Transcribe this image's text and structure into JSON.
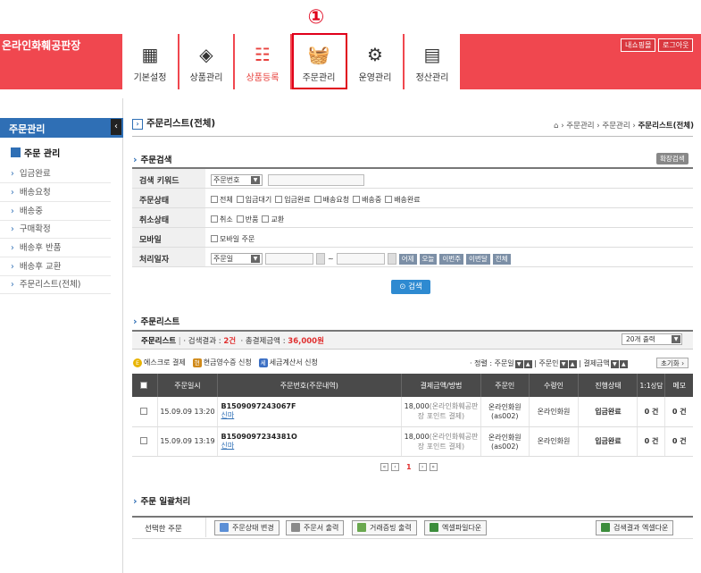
{
  "callout": "①",
  "header": {
    "logo": "온라인화훼공판장",
    "nav": [
      {
        "label": "기본설정",
        "icon": "grid-icon"
      },
      {
        "label": "상품관리",
        "icon": "tag-icon"
      },
      {
        "label": "상품등록",
        "icon": "register-icon"
      },
      {
        "label": "주문관리",
        "icon": "basket-icon"
      },
      {
        "label": "운영관리",
        "icon": "gears-icon"
      },
      {
        "label": "정산관리",
        "icon": "calculator-icon"
      }
    ],
    "my_mall": "내쇼핑몰",
    "logout": "로그아웃"
  },
  "sidebar": {
    "title": "주문관리",
    "group": "주문 관리",
    "items": [
      "입금완료",
      "배송요청",
      "배송중",
      "구매확정",
      "배송후 반품",
      "배송후 교환",
      "주문리스트(전체)"
    ]
  },
  "page": {
    "title": "주문리스트(전체)",
    "breadcrumb_prefix": "⌂ › 주문관리 › 주문관리 › ",
    "breadcrumb_current": "주문리스트(전체)"
  },
  "search": {
    "section_title": "주문검색",
    "extended": "확장검색",
    "rows": {
      "keyword": {
        "label": "검색 키워드",
        "select": "주문번호"
      },
      "order_status": {
        "label": "주문상태",
        "options": [
          "전체",
          "입금대기",
          "입금완료",
          "배송요청",
          "배송중",
          "배송완료"
        ]
      },
      "cancel_status": {
        "label": "취소상태",
        "options": [
          "취소",
          "반품",
          "교환"
        ]
      },
      "mobile": {
        "label": "모바일",
        "options": [
          "모바일 주문"
        ]
      },
      "date": {
        "label": "처리일자",
        "select": "주문일",
        "tilde": "~",
        "quick": [
          "어제",
          "오늘",
          "이번주",
          "이번달",
          "전체"
        ]
      }
    },
    "button": "검색"
  },
  "list": {
    "section_title": "주문리스트",
    "summary_label": "주문리스트",
    "result_label": "· 검색결과 :",
    "result_count": "2건",
    "total_label": "· 총결제금액 :",
    "total_amount": "36,000원",
    "per_page": "20개 출력",
    "legend": [
      {
        "badge": "E",
        "text": "에스크로 결제",
        "color": "#e8b400"
      },
      {
        "badge": "현",
        "text": "현금영수증 신청",
        "color": "#d08a1a"
      },
      {
        "badge": "세",
        "text": "세금계산서 신청",
        "color": "#3b6fc4"
      }
    ],
    "sort_text": "· 정렬 : 주문일",
    "sort_orderer": "| 주문인",
    "sort_amount": "| 결제금액",
    "reset": "초기화 ›",
    "columns": [
      "주문일시",
      "주문번호(주문내역)",
      "결제금액/방법",
      "주문인",
      "수령인",
      "진행상태",
      "1:1상담",
      "메모"
    ],
    "rows": [
      {
        "date": "15.09.09 13:20",
        "order_no": "B1509097243067F",
        "item": "신마",
        "amount": "18,000",
        "method": "(온라인화훼공판장 포인트 결제)",
        "orderer": "온라인화원",
        "orderer_id": "(as002)",
        "receiver": "온라인화원",
        "status": "입금완료",
        "consult": "0 건",
        "memo": "0 건"
      },
      {
        "date": "15.09.09 13:19",
        "order_no": "B1509097234381O",
        "item": "신마",
        "amount": "18,000",
        "method": "(온라인화훼공판장 포인트 결제)",
        "orderer": "온라인화원",
        "orderer_id": "(as002)",
        "receiver": "온라인화원",
        "status": "입금완료",
        "consult": "0 건",
        "memo": "0 건"
      }
    ],
    "pager": {
      "current": "1"
    }
  },
  "bulk": {
    "section_title": "주문 일괄처리",
    "label": "선택한 주문",
    "buttons": [
      "주문상태 변경",
      "주문서 출력",
      "거래증빙 출력",
      "엑셀파일다운"
    ],
    "excel_all": "검색결과 엑셀다운"
  }
}
